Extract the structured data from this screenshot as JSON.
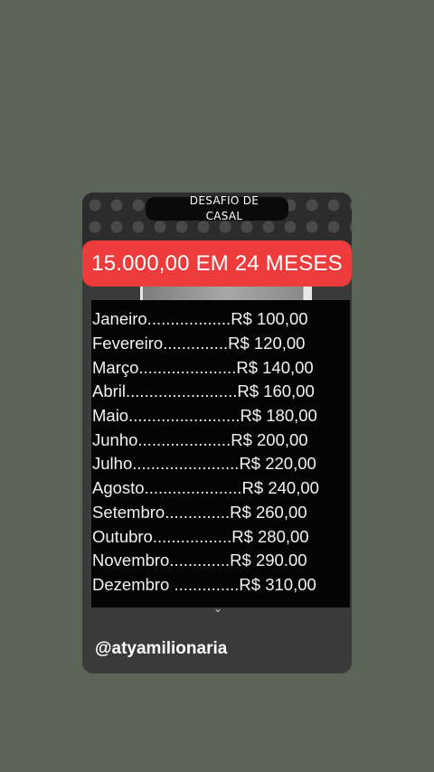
{
  "header": {
    "title_line1": "DESAFIO  DE",
    "title_line2": "CASAL"
  },
  "banner": {
    "text": "15.000,00 EM 24 MESES",
    "color": "#ee3b3b"
  },
  "months": [
    {
      "label": "Janeiro..................R$ 100,00"
    },
    {
      "label": "Fevereiro..............R$ 120,00"
    },
    {
      "label": "Março.....................R$ 140,00"
    },
    {
      "label": "Abril........................R$ 160,00"
    },
    {
      "label": "Maio........................R$ 180,00"
    },
    {
      "label": "Junho....................R$ 200,00"
    },
    {
      "label": "Julho.......................R$ 220,00"
    },
    {
      "label": "Agosto.....................R$ 240,00"
    },
    {
      "label": "Setembro..............R$ 260,00"
    },
    {
      "label": "Outubro.................R$ 280,00"
    },
    {
      "label": "Novembro.............R$ 290.00"
    },
    {
      "label": "Dezembro ..............R$ 310,00"
    }
  ],
  "footer": {
    "handle": "@atyamilionaria",
    "expand_icon": "chevron-down-icon"
  }
}
